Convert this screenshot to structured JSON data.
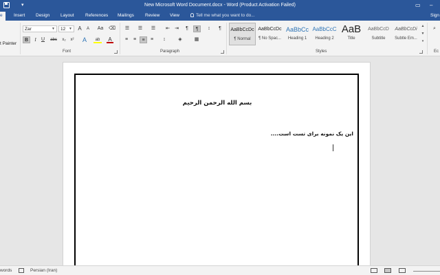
{
  "window": {
    "title": "New Microsoft Word Document.docx - Word (Product Activation Failed)",
    "qat_dropdown": "▾",
    "minimize_glyph": "–",
    "restore_glyph": "❐"
  },
  "tabs": {
    "file_partial": "e",
    "insert": "Insert",
    "design": "Design",
    "layout": "Layout",
    "references": "References",
    "mailings": "Mailings",
    "review": "Review",
    "view": "View",
    "tell_me_placeholder": "Tell me what you want to do...",
    "sign_in_partial": "Sign"
  },
  "ribbon": {
    "clipboard": {
      "format_painter_partial": "t Painter"
    },
    "font": {
      "label": "Font",
      "font_name": "Zar",
      "font_size": "12",
      "grow": "A",
      "shrink": "A",
      "change_case": "Aa",
      "bold": "B",
      "italic": "I",
      "underline": "U",
      "strikethrough": "abc",
      "subscript": "x₂",
      "superscript": "x²",
      "text_effects": "A",
      "highlight": "ab",
      "font_color": "A",
      "font_color_hex": "#c00000",
      "highlight_hex": "#ffff00"
    },
    "paragraph": {
      "label": "Paragraph",
      "ltr": "¶",
      "rtl": "¶",
      "show_marks": "¶"
    },
    "styles": {
      "label": "Styles",
      "items": [
        {
          "preview": "AaBbCcDc",
          "name": "¶ Normal"
        },
        {
          "preview": "AaBbCcDc",
          "name": "¶ No Spac..."
        },
        {
          "preview": "AaBbCc",
          "name": "Heading 1"
        },
        {
          "preview": "AaBbCcC",
          "name": "Heading 2"
        },
        {
          "preview": "AaB",
          "name": "Title"
        },
        {
          "preview": "AaBbCcD",
          "name": "Subtitle"
        },
        {
          "preview": "AaBbCcDi",
          "name": "Subtle Em..."
        }
      ],
      "heading_color_hex": "#2e74b5"
    },
    "editing": {
      "label_partial": "Ec"
    }
  },
  "document": {
    "heading": "بسم الله الرحمن الرحیم",
    "line1": "این یک نمونه برای تست است....",
    "page_border": "box"
  },
  "status": {
    "words_partial": "words",
    "language": "Persian (Iran)"
  },
  "colors": {
    "accent": "#2b579a",
    "ribbon_bg": "#f3f3f3",
    "canvas_bg": "#e6e6e6"
  }
}
